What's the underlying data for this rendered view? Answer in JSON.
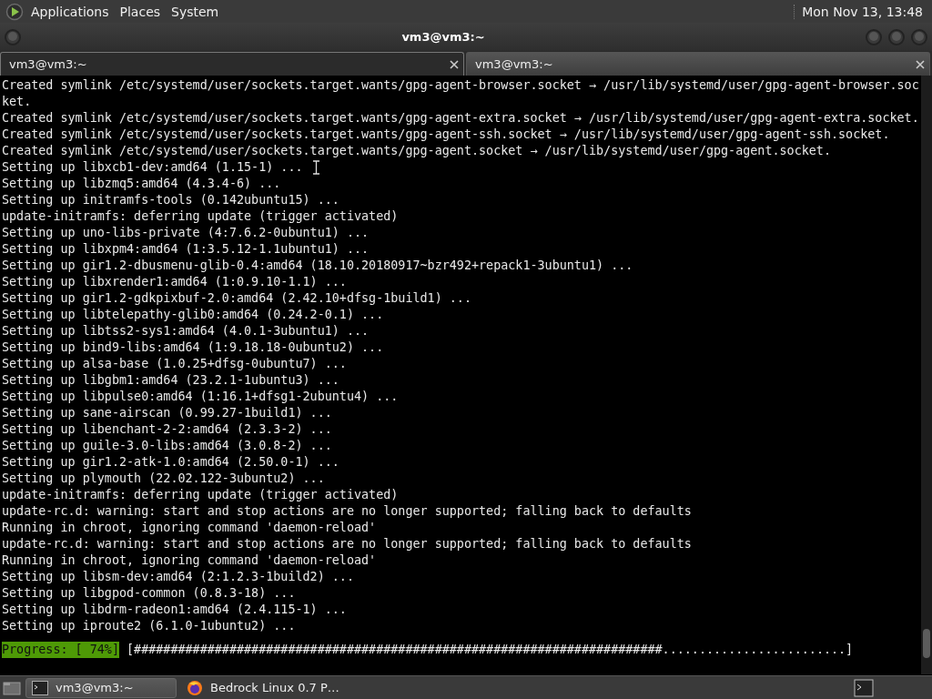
{
  "top_panel": {
    "menus": [
      "Applications",
      "Places",
      "System"
    ],
    "clock": "Mon Nov 13, 13:48"
  },
  "window": {
    "title": "vm3@vm3:~"
  },
  "tabs": [
    {
      "label": "vm3@vm3:~",
      "selected": true
    },
    {
      "label": "vm3@vm3:~",
      "selected": false
    }
  ],
  "terminal": {
    "lines": [
      "Created symlink /etc/systemd/user/sockets.target.wants/gpg-agent-browser.socket → /usr/lib/systemd/user/gpg-agent-browser.soc",
      "ket.",
      "Created symlink /etc/systemd/user/sockets.target.wants/gpg-agent-extra.socket → /usr/lib/systemd/user/gpg-agent-extra.socket.",
      "Created symlink /etc/systemd/user/sockets.target.wants/gpg-agent-ssh.socket → /usr/lib/systemd/user/gpg-agent-ssh.socket.",
      "Created symlink /etc/systemd/user/sockets.target.wants/gpg-agent.socket → /usr/lib/systemd/user/gpg-agent.socket.",
      "Setting up libxcb1-dev:amd64 (1.15-1) ...",
      "Setting up libzmq5:amd64 (4.3.4-6) ...",
      "Setting up initramfs-tools (0.142ubuntu15) ...",
      "update-initramfs: deferring update (trigger activated)",
      "Setting up uno-libs-private (4:7.6.2-0ubuntu1) ...",
      "Setting up libxpm4:amd64 (1:3.5.12-1.1ubuntu1) ...",
      "Setting up gir1.2-dbusmenu-glib-0.4:amd64 (18.10.20180917~bzr492+repack1-3ubuntu1) ...",
      "Setting up libxrender1:amd64 (1:0.9.10-1.1) ...",
      "Setting up gir1.2-gdkpixbuf-2.0:amd64 (2.42.10+dfsg-1build1) ...",
      "Setting up libtelepathy-glib0:amd64 (0.24.2-0.1) ...",
      "Setting up libtss2-sys1:amd64 (4.0.1-3ubuntu1) ...",
      "Setting up bind9-libs:amd64 (1:9.18.18-0ubuntu2) ...",
      "Setting up alsa-base (1.0.25+dfsg-0ubuntu7) ...",
      "Setting up libgbm1:amd64 (23.2.1-1ubuntu3) ...",
      "Setting up libpulse0:amd64 (1:16.1+dfsg1-2ubuntu4) ...",
      "Setting up sane-airscan (0.99.27-1build1) ...",
      "Setting up libenchant-2-2:amd64 (2.3.3-2) ...",
      "Setting up guile-3.0-libs:amd64 (3.0.8-2) ...",
      "Setting up gir1.2-atk-1.0:amd64 (2.50.0-1) ...",
      "Setting up plymouth (22.02.122-3ubuntu2) ...",
      "update-initramfs: deferring update (trigger activated)",
      "update-rc.d: warning: start and stop actions are no longer supported; falling back to defaults",
      "Running in chroot, ignoring command 'daemon-reload'",
      "update-rc.d: warning: start and stop actions are no longer supported; falling back to defaults",
      "Running in chroot, ignoring command 'daemon-reload'",
      "Setting up libsm-dev:amd64 (2:1.2.3-1build2) ...",
      "Setting up libgpod-common (0.8.3-18) ...",
      "Setting up libdrm-radeon1:amd64 (2.4.115-1) ...",
      "Setting up iproute2 (6.1.0-1ubuntu2) ..."
    ],
    "progress_label": "Progress: [ 74%]",
    "progress_bar": "[########################################################################.........................]"
  },
  "taskbar": {
    "items": [
      {
        "label": "vm3@vm3:~",
        "kind": "terminal",
        "selected": true
      },
      {
        "label": "Bedrock Linux 0.7 P…",
        "kind": "browser",
        "selected": false
      }
    ]
  }
}
